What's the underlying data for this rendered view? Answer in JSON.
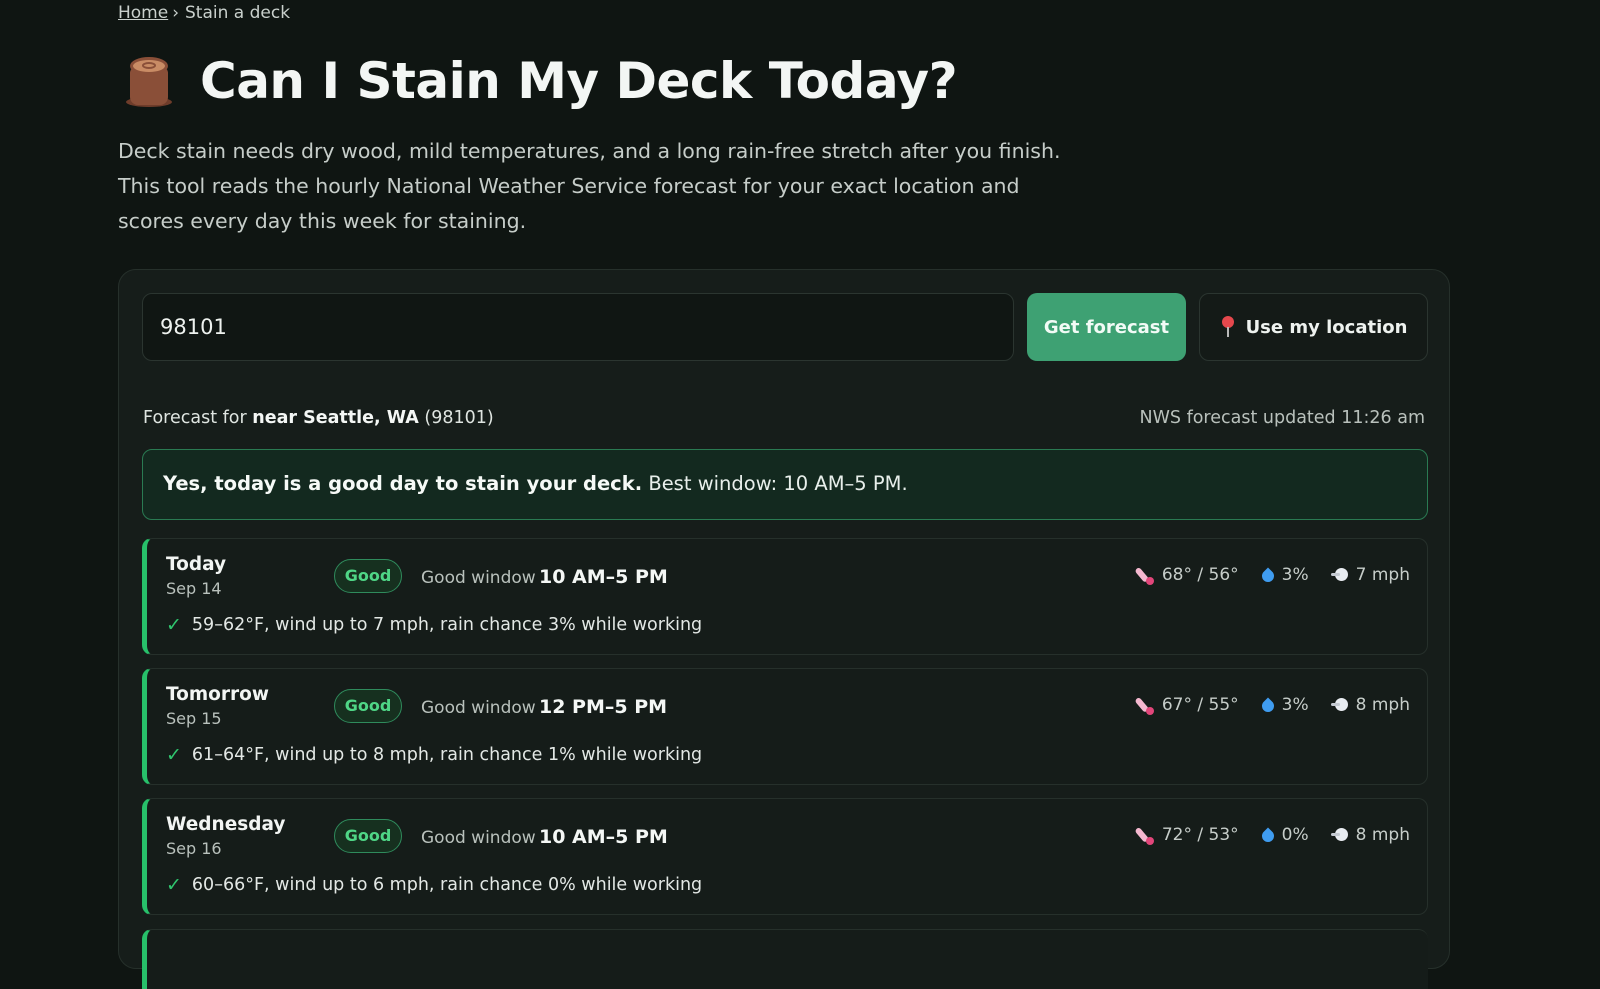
{
  "breadcrumb": {
    "home": "Home",
    "separator": "›",
    "current": "Stain a deck"
  },
  "header": {
    "title": "Can I Stain My Deck Today?",
    "intro": "Deck stain needs dry wood, mild temperatures, and a long rain-free stretch after you finish. This tool reads the hourly National Weather Service forecast for your exact location and scores every day this week for staining."
  },
  "search": {
    "zip_value": "98101",
    "get_forecast_label": "Get forecast",
    "use_location_label": "Use my location"
  },
  "forecast_meta": {
    "prefix": "Forecast for",
    "place": "near Seattle, WA",
    "zip": "(98101)",
    "updated": "NWS forecast updated 11:26 am"
  },
  "verdict": {
    "headline": "Yes, today is a good day to stain your deck.",
    "detail": "Best window: 10 AM–5 PM."
  },
  "colors": {
    "accent": "#3ea173",
    "good": "#27c06a",
    "background": "#0f1512"
  },
  "days": [
    {
      "name": "Today",
      "date": "Sep 14",
      "badge": "Good",
      "window_label": "Good window",
      "window": "10 AM–5 PM",
      "temp": "68° / 56°",
      "rain": "3%",
      "wind": "7 mph",
      "summary": "59–62°F, wind up to 7 mph, rain chance 3% while working"
    },
    {
      "name": "Tomorrow",
      "date": "Sep 15",
      "badge": "Good",
      "window_label": "Good window",
      "window": "12 PM–5 PM",
      "temp": "67° / 55°",
      "rain": "3%",
      "wind": "8 mph",
      "summary": "61–64°F, wind up to 8 mph, rain chance 1% while working"
    },
    {
      "name": "Wednesday",
      "date": "Sep 16",
      "badge": "Good",
      "window_label": "Good window",
      "window": "10 AM–5 PM",
      "temp": "72° / 53°",
      "rain": "0%",
      "wind": "8 mph",
      "summary": "60–66°F, wind up to 6 mph, rain chance 0% while working"
    }
  ],
  "icons": {
    "title": "wood-log-icon",
    "location": "pin-icon",
    "temperature": "thermometer-icon",
    "rain": "droplet-icon",
    "wind": "wind-icon",
    "check": "check-icon"
  }
}
